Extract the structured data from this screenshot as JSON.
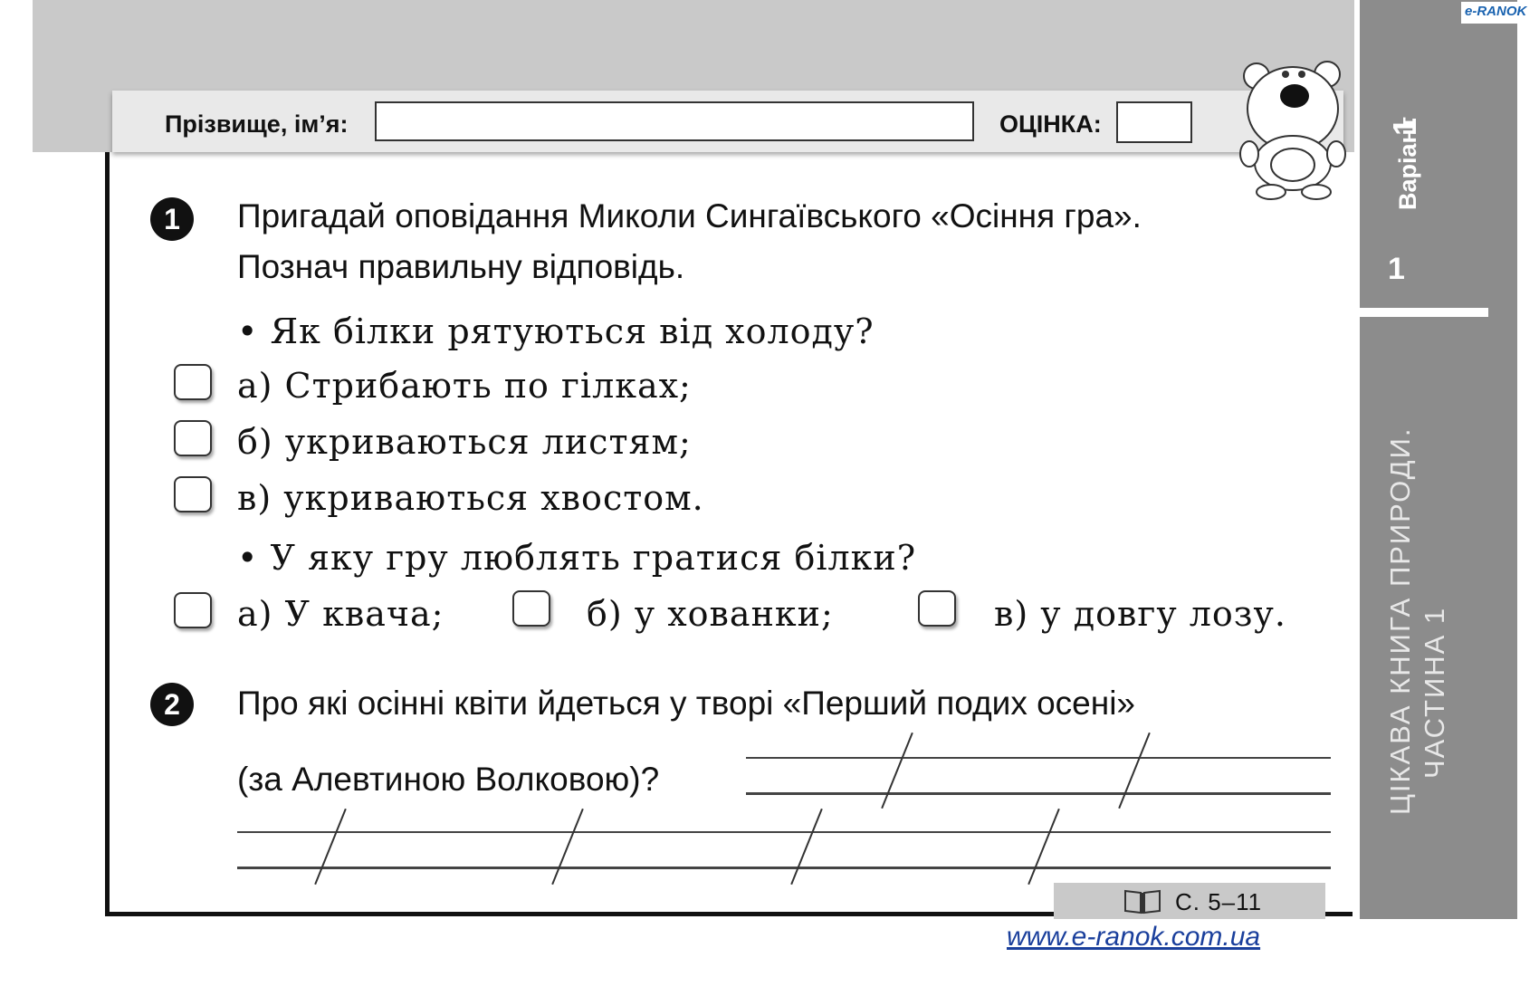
{
  "header": {
    "name_label": "Прізвище, ім’я:",
    "grade_label": "ОЦІНКА:"
  },
  "logo": {
    "text": "e-RANOK"
  },
  "sidebar": {
    "variant_label": "Варіант",
    "variant_number": "1",
    "section_number": "1",
    "book_title_line1": "ЦІКАВА КНИГА ПРИРОДИ.",
    "book_title_line2": "ЧАСТИНА 1"
  },
  "task1": {
    "number": "1",
    "prompt_line1": "Пригадай оповідання Миколи Сингаївського «Осіння гра».",
    "prompt_line2": "Познач правильну відповідь.",
    "question1": "• Як білки рятуються від холоду?",
    "q1_options": [
      "а) Стрибають по гілках;",
      "б) укриваються листям;",
      "в) укриваються хвостом."
    ],
    "question2": "• У яку гру люблять гратися білки?",
    "q2_options": [
      "а) У квача;",
      "б) у хованки;",
      "в) у довгу лозу."
    ]
  },
  "task2": {
    "number": "2",
    "prompt_line1": "Про які осінні квіти йдеться у творі «Перший подих осені»",
    "prompt_line2": "(за Алевтиною Волковою)?"
  },
  "footer": {
    "pages": "С. 5–11",
    "website": "www.e-ranok.com.ua"
  }
}
